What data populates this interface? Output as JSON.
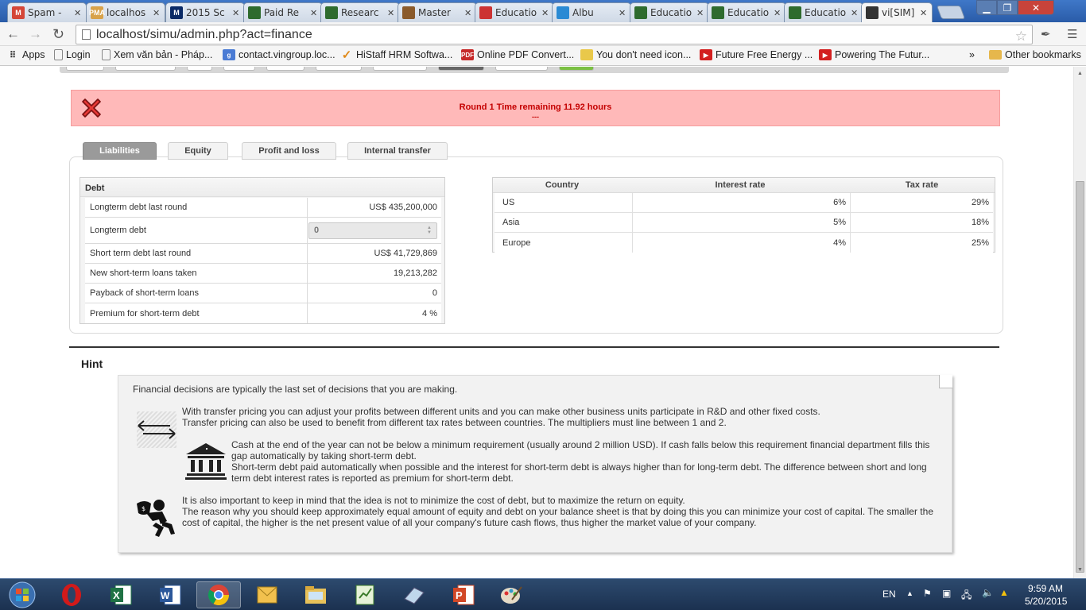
{
  "browser": {
    "tabs": [
      {
        "title": "Spam -",
        "icon_color": "#d44638",
        "icon": "gmail-icon",
        "glyph": "M"
      },
      {
        "title": "localhos",
        "icon_color": "#d8a24a",
        "icon": "pma-icon",
        "glyph": "PMA"
      },
      {
        "title": "2015 Sc",
        "icon_color": "#0a2a66",
        "icon": "michigan-icon",
        "glyph": "M"
      },
      {
        "title": "Paid Re",
        "icon_color": "#2e6b2e",
        "icon": "shield-icon",
        "glyph": ""
      },
      {
        "title": "Researc",
        "icon_color": "#2e6b2e",
        "icon": "shield-icon",
        "glyph": ""
      },
      {
        "title": "Master",
        "icon_color": "#8a5a2b",
        "icon": "building-icon",
        "glyph": ""
      },
      {
        "title": "Educatio",
        "icon_color": "#c33",
        "icon": "flag-icon",
        "glyph": ""
      },
      {
        "title": "Albu",
        "icon_color": "#2a8ad4",
        "icon": "album-icon",
        "glyph": ""
      },
      {
        "title": "Educatio",
        "icon_color": "#2e6b2e",
        "icon": "shield-icon",
        "glyph": ""
      },
      {
        "title": "Educatio",
        "icon_color": "#2e6b2e",
        "icon": "shield-icon",
        "glyph": ""
      },
      {
        "title": "Educatio",
        "icon_color": "#2e6b2e",
        "icon": "shield-icon",
        "glyph": ""
      },
      {
        "title": "vi[SIM]",
        "icon_color": "#333333",
        "icon": "bar-chart-icon",
        "glyph": ""
      }
    ],
    "url": "localhost/simu/admin.php?act=finance",
    "bookmarks": [
      {
        "label": "Apps"
      },
      {
        "label": "Login"
      },
      {
        "label": "Xem văn bản - Pháp..."
      },
      {
        "label": "contact.vingroup.loc..."
      },
      {
        "label": "HiStaff HRM Softwa..."
      },
      {
        "label": "Online PDF Convert..."
      },
      {
        "label": "You don't need icon..."
      },
      {
        "label": "Future Free Energy ..."
      },
      {
        "label": "Powering The Futur..."
      },
      {
        "label": "»"
      },
      {
        "label": "Other bookmarks"
      }
    ]
  },
  "alert": {
    "message": "Round 1 Time remaining 11.92 hours",
    "sub": "---"
  },
  "section_tabs": [
    "Liabilities",
    "Equity",
    "Profit and loss",
    "Internal transfer"
  ],
  "debt": {
    "title": "Debt",
    "rows": [
      {
        "label": "Longterm debt last round",
        "value": "US$ 435,200,000"
      },
      {
        "label": "Longterm debt",
        "value": "0"
      },
      {
        "label": "Short term debt last round",
        "value": "US$ 41,729,869"
      },
      {
        "label": "New short-term loans taken",
        "value": "19,213,282"
      },
      {
        "label": "Payback of short-term loans",
        "value": "0"
      },
      {
        "label": "Premium for short-term debt",
        "value": "4 %"
      }
    ]
  },
  "rates": {
    "headers": [
      "Country",
      "Interest rate",
      "Tax rate"
    ],
    "rows": [
      {
        "country": "US",
        "interest": "6%",
        "tax": "29%"
      },
      {
        "country": "Asia",
        "interest": "5%",
        "tax": "18%"
      },
      {
        "country": "Europe",
        "interest": "4%",
        "tax": "25%"
      }
    ]
  },
  "hint": {
    "title": "Hint",
    "intro": "Financial decisions are typically the last set of decisions that you are making.",
    "transfer_1": "With transfer pricing you can adjust your profits between different units and you can make other business units participate in R&D and other fixed costs.",
    "transfer_2": "Transfer pricing can also be used to benefit from different tax rates between countries. The multipliers must line between 1 and 2.",
    "cash_1": "Cash at the end of the year can not be below a minimum requirement (usually around 2 million USD). If cash falls below this requirement financial department fills this gap automatically by taking short-term debt.",
    "cash_2": "Short-term debt paid automatically when possible and the interest for short-term debt is always higher than for long-term debt. The difference between short and long term debt interest rates is reported as premium for short-term debt.",
    "equity_1": "It is also important to keep in mind that the idea is not to minimize the cost of debt, but to maximize the return on equity.",
    "equity_2": "The reason why you should keep approximately equal amount of equity and debt on your balance sheet is that by doing this you can minimize your cost of capital. The smaller the cost of capital, the higher is the net present value of all your company's future cash flows, thus higher the market value of your company."
  },
  "taskbar": {
    "lang": "EN",
    "time": "9:59 AM",
    "date": "5/20/2015",
    "apps": [
      "opera-icon",
      "excel-icon",
      "word-icon",
      "chrome-icon",
      "outlook-icon",
      "file-explorer-icon",
      "project-icon",
      "eraser-icon",
      "powerpoint-icon",
      "paint-icon"
    ]
  }
}
